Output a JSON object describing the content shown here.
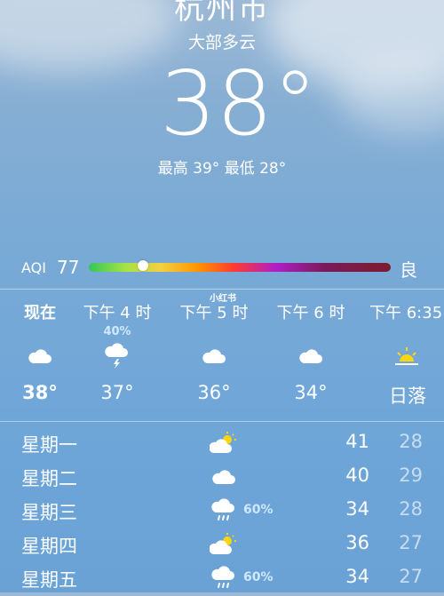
{
  "header": {
    "city": "杭州市",
    "condition": "大部多云",
    "temperature": "38°",
    "high_low": "最高 39°  最低 28°"
  },
  "aqi": {
    "label": "AQI",
    "value": "77",
    "level": "良",
    "scale_position": 0.18
  },
  "watermark": "小红书",
  "hourly": [
    {
      "time": "现在",
      "precip": "",
      "icon": "cloud-icon",
      "temp": "38°"
    },
    {
      "time": "下午 4 时",
      "precip": "40%",
      "icon": "thunderstorm-icon",
      "temp": "37°"
    },
    {
      "time": "下午 5 时",
      "precip": "",
      "icon": "cloud-icon",
      "temp": "36°"
    },
    {
      "time": "下午 6 时",
      "precip": "",
      "icon": "cloud-icon",
      "temp": "34°"
    },
    {
      "time": "下午 6:35",
      "precip": "",
      "icon": "sunset-icon",
      "temp": "日落"
    }
  ],
  "daily": [
    {
      "day": "星期一",
      "icon": "partly-sunny-icon",
      "precip": "",
      "high": "41",
      "low": "28"
    },
    {
      "day": "星期二",
      "icon": "cloud-icon",
      "precip": "",
      "high": "40",
      "low": "29"
    },
    {
      "day": "星期三",
      "icon": "rain-cloud-icon",
      "precip": "60%",
      "high": "34",
      "low": "28"
    },
    {
      "day": "星期四",
      "icon": "partly-sunny-icon",
      "precip": "",
      "high": "36",
      "low": "27"
    },
    {
      "day": "星期五",
      "icon": "rain-cloud-icon",
      "precip": "60%",
      "high": "34",
      "low": "27"
    }
  ],
  "colors": {
    "precip_text": "#cfe8ff",
    "sun": "#ffd60a"
  }
}
